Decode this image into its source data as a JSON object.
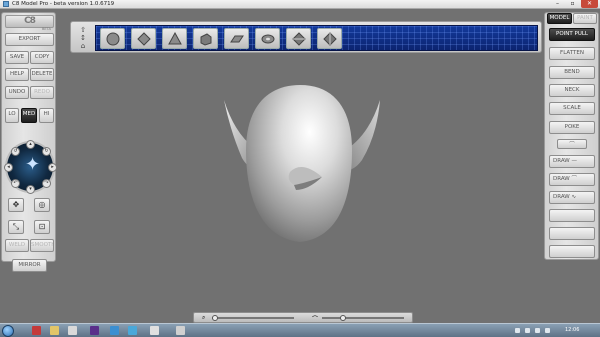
{
  "window": {
    "title": "C8 Model Pro - beta version 1.0.6719",
    "min_label": "–",
    "max_label": "▫",
    "close_label": "✕"
  },
  "left_panel": {
    "logo": "C8",
    "logo_sub": "BETA",
    "export": "EXPORT",
    "save": "SAVE",
    "copy": "COPY",
    "help": "HELP",
    "delete": "DELETE",
    "undo": "UNDO",
    "redo": "REDO",
    "lo": "LO",
    "med": "MED",
    "hi": "HI",
    "mirror": "MIRROR",
    "weld": "WELD",
    "smooth": "SMOOTH"
  },
  "right_panel": {
    "model_tab": "MODEL",
    "paint_tab": "PAINT",
    "tools": [
      "POINT PULL",
      "FLATTEN",
      "BEND",
      "NECK",
      "SCALE",
      "POKE"
    ],
    "draw": "DRAW"
  },
  "taskbar": {
    "clock": "12:06"
  },
  "colors": {
    "shelf": "#133a9c",
    "accent_active": "#1e1e1e",
    "close": "#c74a3a"
  }
}
